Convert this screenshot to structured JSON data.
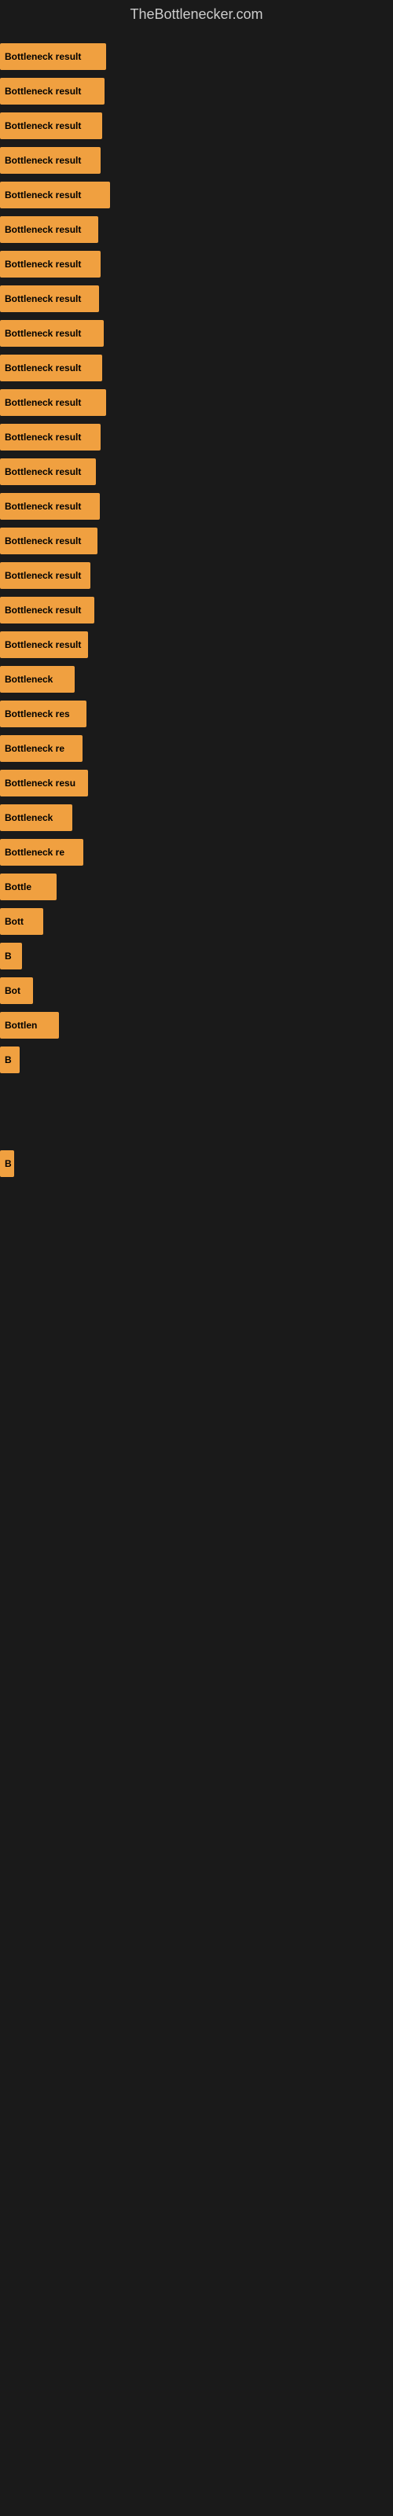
{
  "site": {
    "title": "TheBottlenecker.com"
  },
  "bars": [
    {
      "label": "Bottleneck result",
      "width": 135
    },
    {
      "label": "Bottleneck result",
      "width": 133
    },
    {
      "label": "Bottleneck result",
      "width": 130
    },
    {
      "label": "Bottleneck result",
      "width": 128
    },
    {
      "label": "Bottleneck result",
      "width": 140
    },
    {
      "label": "Bottleneck result",
      "width": 125
    },
    {
      "label": "Bottleneck result",
      "width": 128
    },
    {
      "label": "Bottleneck result",
      "width": 126
    },
    {
      "label": "Bottleneck result",
      "width": 132
    },
    {
      "label": "Bottleneck result",
      "width": 130
    },
    {
      "label": "Bottleneck result",
      "width": 135
    },
    {
      "label": "Bottleneck result",
      "width": 128
    },
    {
      "label": "Bottleneck result",
      "width": 122
    },
    {
      "label": "Bottleneck result",
      "width": 127
    },
    {
      "label": "Bottleneck result",
      "width": 124
    },
    {
      "label": "Bottleneck result",
      "width": 115
    },
    {
      "label": "Bottleneck result",
      "width": 120
    },
    {
      "label": "Bottleneck result",
      "width": 112
    },
    {
      "label": "Bottleneck",
      "width": 95
    },
    {
      "label": "Bottleneck res",
      "width": 110
    },
    {
      "label": "Bottleneck re",
      "width": 105
    },
    {
      "label": "Bottleneck resu",
      "width": 112
    },
    {
      "label": "Bottleneck",
      "width": 92
    },
    {
      "label": "Bottleneck re",
      "width": 106
    },
    {
      "label": "Bottle",
      "width": 72
    },
    {
      "label": "Bott",
      "width": 55
    },
    {
      "label": "B",
      "width": 28
    },
    {
      "label": "Bot",
      "width": 42
    },
    {
      "label": "Bottlen",
      "width": 75
    },
    {
      "label": "B",
      "width": 25
    },
    {
      "label": "",
      "width": 0
    },
    {
      "label": "",
      "width": 0
    },
    {
      "label": "B",
      "width": 18
    },
    {
      "label": "",
      "width": 0
    },
    {
      "label": "",
      "width": 0
    },
    {
      "label": "",
      "width": 0
    },
    {
      "label": "",
      "width": 0
    }
  ]
}
